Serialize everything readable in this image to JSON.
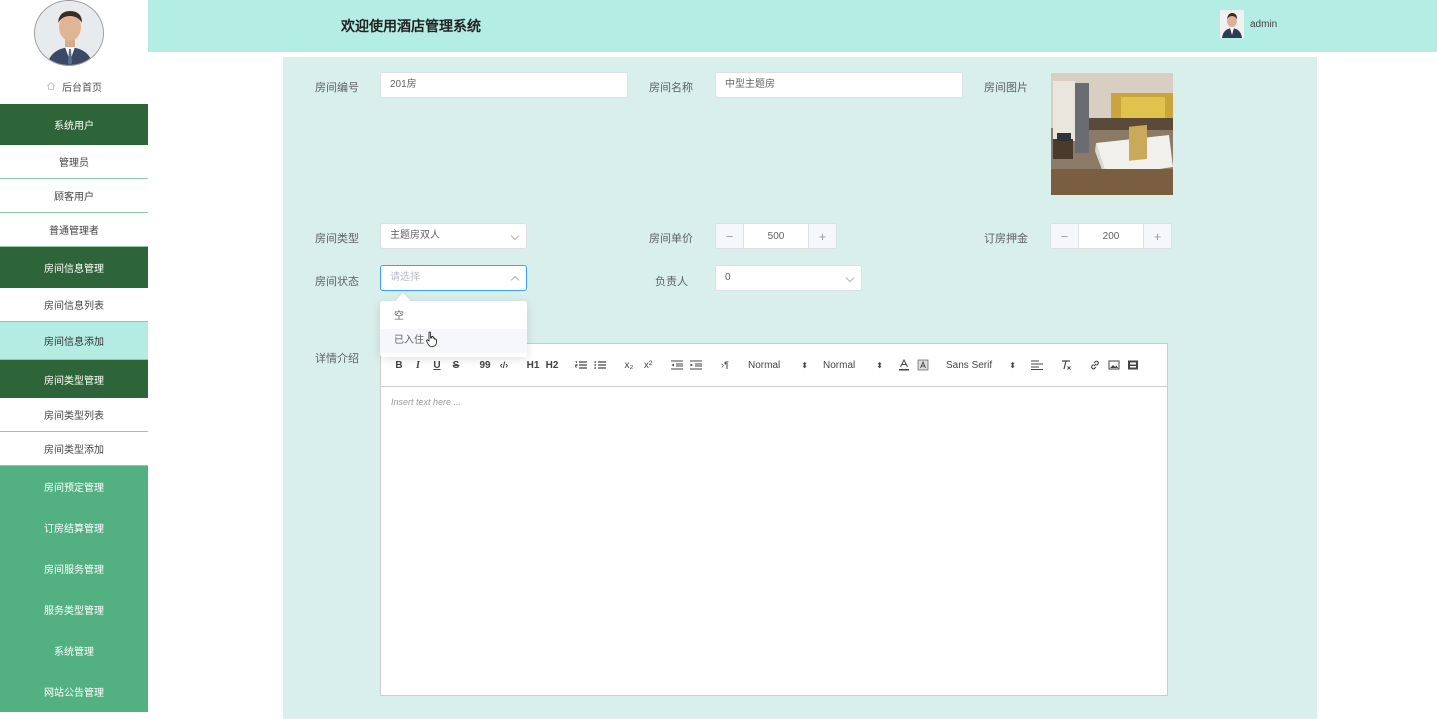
{
  "header": {
    "title": "欢迎使用酒店管理系统",
    "user": "admin"
  },
  "sidebar": {
    "home": "后台首页",
    "groups": [
      {
        "label": "系统用户",
        "items": [
          "管理员",
          "顾客用户",
          "普通管理者"
        ]
      },
      {
        "label": "房间信息管理",
        "items": [
          "房间信息列表",
          "房间信息添加"
        ]
      },
      {
        "label": "房间类型管理",
        "items": [
          "房间类型列表",
          "房间类型添加"
        ]
      }
    ],
    "active_item": "房间信息添加",
    "more": [
      "房间预定管理",
      "订房结算管理",
      "房间服务管理",
      "服务类型管理",
      "系统管理",
      "网站公告管理"
    ]
  },
  "form": {
    "room_no": {
      "label": "房间编号",
      "value": "201房"
    },
    "room_name": {
      "label": "房间名称",
      "value": "中型主题房"
    },
    "room_image": {
      "label": "房间图片"
    },
    "room_type": {
      "label": "房间类型",
      "value": "主题房双人"
    },
    "unit_price": {
      "label": "房间单价",
      "value": "500",
      "minus": "−",
      "plus": "+"
    },
    "deposit": {
      "label": "订房押金",
      "value": "200",
      "minus": "−",
      "plus": "+"
    },
    "room_status": {
      "label": "房间状态",
      "placeholder": "请选择",
      "options": [
        "空",
        "已入住"
      ]
    },
    "owner": {
      "label": "负责人",
      "value": "0"
    },
    "detail": {
      "label": "详情介绍",
      "placeholder": "Insert text here ..."
    }
  },
  "editor_toolbar": {
    "bold": "B",
    "italic": "I",
    "underline": "U",
    "strike": "S",
    "quote": "99",
    "code": "‹/›",
    "h1": "H1",
    "h2": "H2",
    "sub": "x₂",
    "sup": "x²",
    "rtl": "›¶",
    "size": "Normal",
    "header": "Normal",
    "font": "Sans Serif"
  },
  "colors": {
    "sidebar_dark": "#2e6538",
    "sidebar_light": "#53b181",
    "header_bg": "#b4ede3",
    "panel_bg": "#d9efeb"
  }
}
